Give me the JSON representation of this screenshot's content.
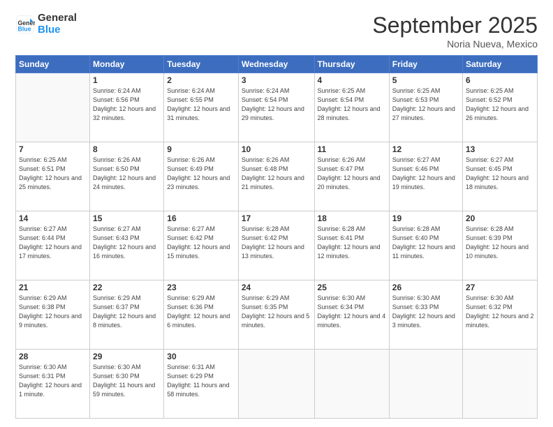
{
  "header": {
    "logo_line1": "General",
    "logo_line2": "Blue",
    "month_title": "September 2025",
    "location": "Noria Nueva, Mexico"
  },
  "weekdays": [
    "Sunday",
    "Monday",
    "Tuesday",
    "Wednesday",
    "Thursday",
    "Friday",
    "Saturday"
  ],
  "weeks": [
    [
      {
        "day": null
      },
      {
        "day": "1",
        "sunrise": "6:24 AM",
        "sunset": "6:56 PM",
        "daylight": "12 hours and 32 minutes."
      },
      {
        "day": "2",
        "sunrise": "6:24 AM",
        "sunset": "6:55 PM",
        "daylight": "12 hours and 31 minutes."
      },
      {
        "day": "3",
        "sunrise": "6:24 AM",
        "sunset": "6:54 PM",
        "daylight": "12 hours and 29 minutes."
      },
      {
        "day": "4",
        "sunrise": "6:25 AM",
        "sunset": "6:54 PM",
        "daylight": "12 hours and 28 minutes."
      },
      {
        "day": "5",
        "sunrise": "6:25 AM",
        "sunset": "6:53 PM",
        "daylight": "12 hours and 27 minutes."
      },
      {
        "day": "6",
        "sunrise": "6:25 AM",
        "sunset": "6:52 PM",
        "daylight": "12 hours and 26 minutes."
      }
    ],
    [
      {
        "day": "7",
        "sunrise": "6:25 AM",
        "sunset": "6:51 PM",
        "daylight": "12 hours and 25 minutes."
      },
      {
        "day": "8",
        "sunrise": "6:26 AM",
        "sunset": "6:50 PM",
        "daylight": "12 hours and 24 minutes."
      },
      {
        "day": "9",
        "sunrise": "6:26 AM",
        "sunset": "6:49 PM",
        "daylight": "12 hours and 23 minutes."
      },
      {
        "day": "10",
        "sunrise": "6:26 AM",
        "sunset": "6:48 PM",
        "daylight": "12 hours and 21 minutes."
      },
      {
        "day": "11",
        "sunrise": "6:26 AM",
        "sunset": "6:47 PM",
        "daylight": "12 hours and 20 minutes."
      },
      {
        "day": "12",
        "sunrise": "6:27 AM",
        "sunset": "6:46 PM",
        "daylight": "12 hours and 19 minutes."
      },
      {
        "day": "13",
        "sunrise": "6:27 AM",
        "sunset": "6:45 PM",
        "daylight": "12 hours and 18 minutes."
      }
    ],
    [
      {
        "day": "14",
        "sunrise": "6:27 AM",
        "sunset": "6:44 PM",
        "daylight": "12 hours and 17 minutes."
      },
      {
        "day": "15",
        "sunrise": "6:27 AM",
        "sunset": "6:43 PM",
        "daylight": "12 hours and 16 minutes."
      },
      {
        "day": "16",
        "sunrise": "6:27 AM",
        "sunset": "6:42 PM",
        "daylight": "12 hours and 15 minutes."
      },
      {
        "day": "17",
        "sunrise": "6:28 AM",
        "sunset": "6:42 PM",
        "daylight": "12 hours and 13 minutes."
      },
      {
        "day": "18",
        "sunrise": "6:28 AM",
        "sunset": "6:41 PM",
        "daylight": "12 hours and 12 minutes."
      },
      {
        "day": "19",
        "sunrise": "6:28 AM",
        "sunset": "6:40 PM",
        "daylight": "12 hours and 11 minutes."
      },
      {
        "day": "20",
        "sunrise": "6:28 AM",
        "sunset": "6:39 PM",
        "daylight": "12 hours and 10 minutes."
      }
    ],
    [
      {
        "day": "21",
        "sunrise": "6:29 AM",
        "sunset": "6:38 PM",
        "daylight": "12 hours and 9 minutes."
      },
      {
        "day": "22",
        "sunrise": "6:29 AM",
        "sunset": "6:37 PM",
        "daylight": "12 hours and 8 minutes."
      },
      {
        "day": "23",
        "sunrise": "6:29 AM",
        "sunset": "6:36 PM",
        "daylight": "12 hours and 6 minutes."
      },
      {
        "day": "24",
        "sunrise": "6:29 AM",
        "sunset": "6:35 PM",
        "daylight": "12 hours and 5 minutes."
      },
      {
        "day": "25",
        "sunrise": "6:30 AM",
        "sunset": "6:34 PM",
        "daylight": "12 hours and 4 minutes."
      },
      {
        "day": "26",
        "sunrise": "6:30 AM",
        "sunset": "6:33 PM",
        "daylight": "12 hours and 3 minutes."
      },
      {
        "day": "27",
        "sunrise": "6:30 AM",
        "sunset": "6:32 PM",
        "daylight": "12 hours and 2 minutes."
      }
    ],
    [
      {
        "day": "28",
        "sunrise": "6:30 AM",
        "sunset": "6:31 PM",
        "daylight": "12 hours and 1 minute."
      },
      {
        "day": "29",
        "sunrise": "6:30 AM",
        "sunset": "6:30 PM",
        "daylight": "11 hours and 59 minutes."
      },
      {
        "day": "30",
        "sunrise": "6:31 AM",
        "sunset": "6:29 PM",
        "daylight": "11 hours and 58 minutes."
      },
      {
        "day": null
      },
      {
        "day": null
      },
      {
        "day": null
      },
      {
        "day": null
      }
    ]
  ]
}
